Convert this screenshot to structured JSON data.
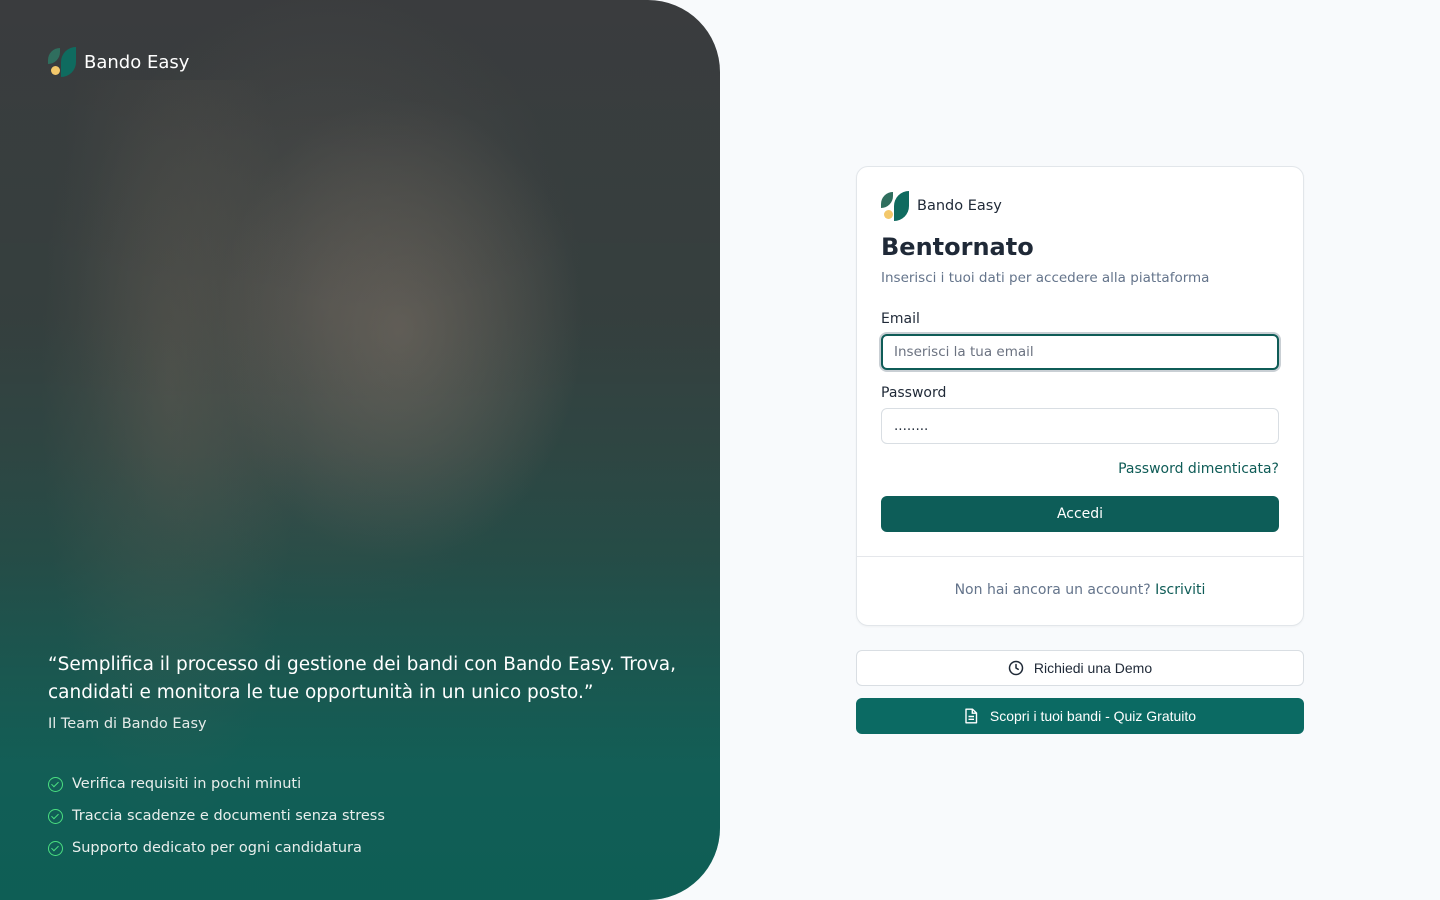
{
  "brand": {
    "name": "Bando Easy",
    "colors": {
      "primary": "#0d5d58",
      "accent": "#0b6a63",
      "leaf_light": "#2f6e5e",
      "dot": "#f3c86b",
      "check": "#4ade80"
    }
  },
  "hero": {
    "quote": "“Semplifica il processo di gestione dei bandi con Bando Easy. Trova, candidati e monitora le tue opportunità in un unico posto.”",
    "author": "Il Team di Bando Easy",
    "features": [
      "Verifica requisiti in pochi minuti",
      "Traccia scadenze e documenti senza stress",
      "Supporto dedicato per ogni candidatura"
    ],
    "feature_icon": "check-circle-icon"
  },
  "login": {
    "title": "Bentornato",
    "subtitle": "Inserisci i tuoi dati per accedere alla piattaforma",
    "email_label": "Email",
    "email_placeholder": "Inserisci la tua email",
    "email_value": "",
    "password_label": "Password",
    "password_value": "........",
    "forgot_link": "Password dimenticata?",
    "submit_label": "Accedi",
    "signup_prompt": "Non hai ancora un account?",
    "signup_link": "Iscriviti"
  },
  "actions": {
    "demo_label": "Richiedi una Demo",
    "demo_icon": "clock-icon",
    "quiz_label": "Scopri i tuoi bandi - Quiz Gratuito",
    "quiz_icon": "document-icon"
  }
}
